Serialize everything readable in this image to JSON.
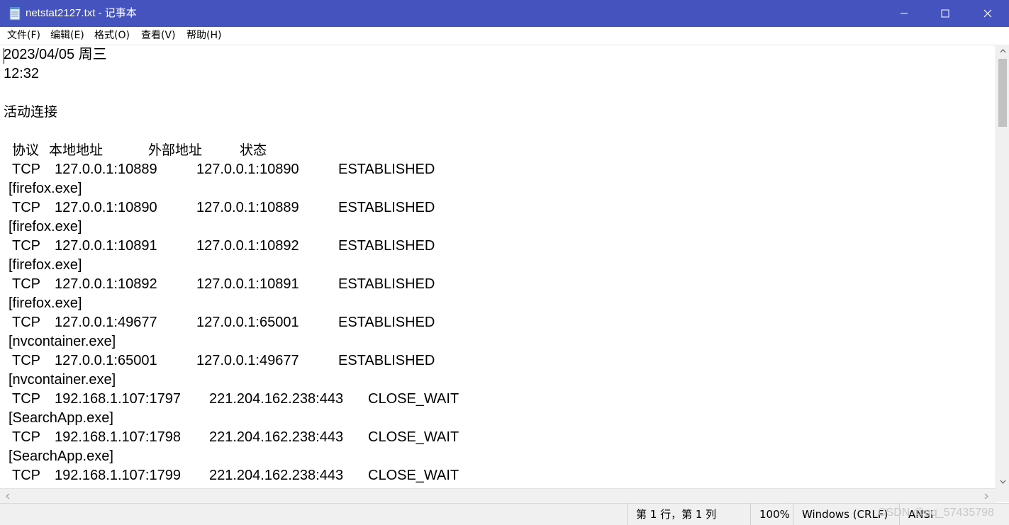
{
  "window": {
    "title": "netstat2127.txt - 记事本",
    "title_bar_color": "#4453be",
    "icons": {
      "app": "notepad-icon",
      "minimize": "minimize-icon",
      "maximize": "maximize-icon",
      "close": "close-icon"
    }
  },
  "menu": {
    "file": "文件(F)",
    "edit": "编辑(E)",
    "format": "格式(O)",
    "view": "查看(V)",
    "help": "帮助(H)"
  },
  "document": {
    "date": "2023/04/05 周三",
    "time": "12:32",
    "section_title": "活动连接",
    "headers": {
      "proto": "协议",
      "local": "本地地址",
      "foreign": "外部地址",
      "state": "状态"
    },
    "connections": [
      {
        "proto": "TCP",
        "local": "127.0.0.1:10889",
        "foreign": "127.0.0.1:10890",
        "state": "ESTABLISHED",
        "process": "[firefox.exe]"
      },
      {
        "proto": "TCP",
        "local": "127.0.0.1:10890",
        "foreign": "127.0.0.1:10889",
        "state": "ESTABLISHED",
        "process": "[firefox.exe]"
      },
      {
        "proto": "TCP",
        "local": "127.0.0.1:10891",
        "foreign": "127.0.0.1:10892",
        "state": "ESTABLISHED",
        "process": "[firefox.exe]"
      },
      {
        "proto": "TCP",
        "local": "127.0.0.1:10892",
        "foreign": "127.0.0.1:10891",
        "state": "ESTABLISHED",
        "process": "[firefox.exe]"
      },
      {
        "proto": "TCP",
        "local": "127.0.0.1:49677",
        "foreign": "127.0.0.1:65001",
        "state": "ESTABLISHED",
        "process": "[nvcontainer.exe]"
      },
      {
        "proto": "TCP",
        "local": "127.0.0.1:65001",
        "foreign": "127.0.0.1:49677",
        "state": "ESTABLISHED",
        "process": "[nvcontainer.exe]"
      },
      {
        "proto": "TCP",
        "local": "192.168.1.107:1797",
        "foreign": "221.204.162.238:443",
        "state": "CLOSE_WAIT",
        "process": "[SearchApp.exe]"
      },
      {
        "proto": "TCP",
        "local": "192.168.1.107:1798",
        "foreign": "221.204.162.238:443",
        "state": "CLOSE_WAIT",
        "process": "[SearchApp.exe]"
      },
      {
        "proto": "TCP",
        "local": "192.168.1.107:1799",
        "foreign": "221.204.162.238:443",
        "state": "CLOSE_WAIT",
        "process": ""
      }
    ]
  },
  "statusbar": {
    "position": "第 1 行，第 1 列",
    "zoom": "100%",
    "line_ending": "Windows (CRLF)",
    "encoding": "ANSI",
    "watermark": "CSDN @qq_57435798"
  }
}
